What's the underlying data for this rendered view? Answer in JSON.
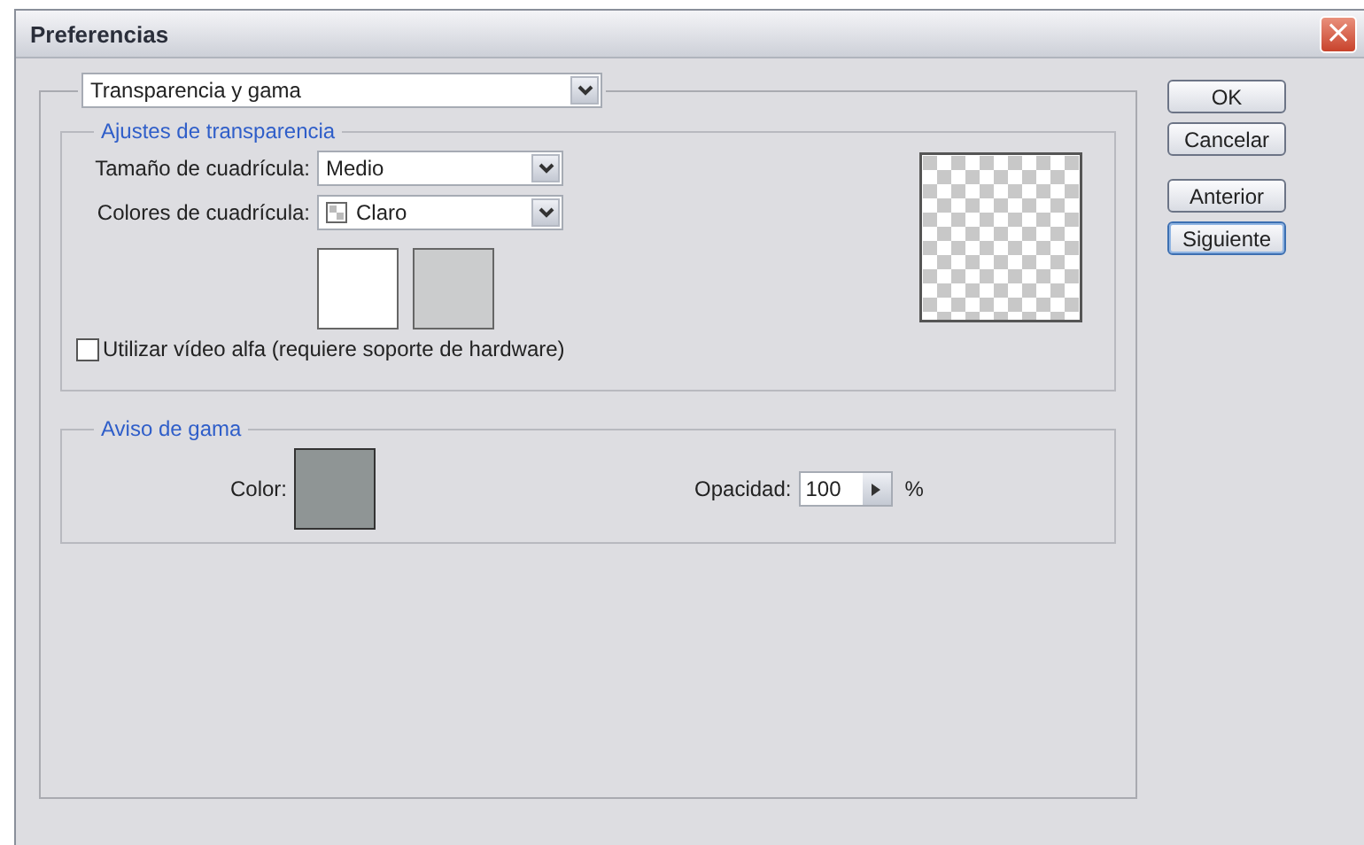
{
  "window": {
    "title": "Preferencias",
    "close": "×"
  },
  "section_select": {
    "value": "Transparencia y gama"
  },
  "transparency": {
    "title": "Ajustes de transparencia",
    "grid_size": {
      "label": "Tamaño de cuadrícula:",
      "value": "Medio"
    },
    "grid_colors": {
      "label": "Colores de cuadrícula:",
      "value": "Claro"
    },
    "swatches": [
      {
        "color": "#ffffff"
      },
      {
        "color": "#cbcccd"
      }
    ],
    "alpha_video": {
      "label": "Utilizar vídeo alfa (requiere soporte de hardware)",
      "checked": false
    }
  },
  "gamut": {
    "title": "Aviso de gama",
    "color_label": "Color:",
    "color": "#8f9595",
    "opacity_label": "Opacidad:",
    "opacity": "100",
    "unit": "%"
  },
  "buttons": [
    {
      "label": "OK",
      "selected": false
    },
    {
      "label": "Cancelar",
      "selected": false
    },
    {
      "label": "Anterior",
      "selected": false
    },
    {
      "label": "Siguiente",
      "selected": true
    }
  ]
}
